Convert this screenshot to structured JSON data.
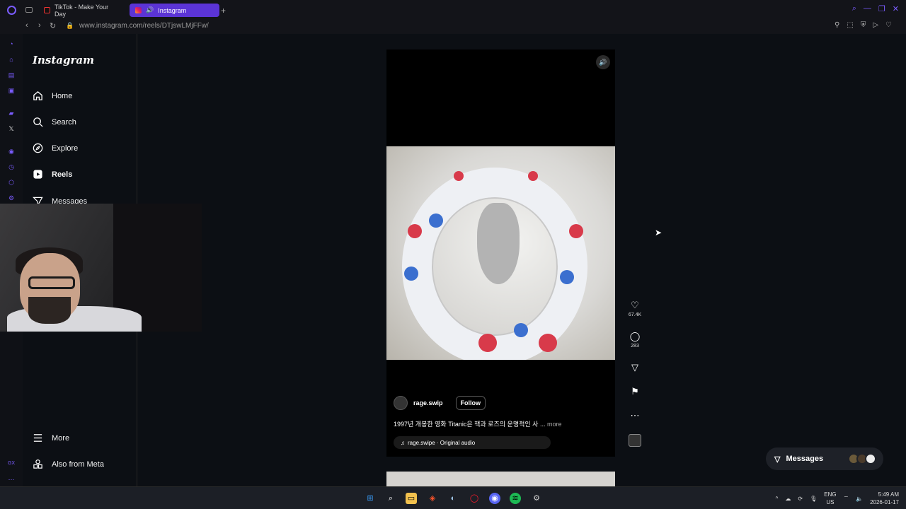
{
  "browser": {
    "tabs": [
      {
        "label": "TikTok - Make Your Day",
        "active": false
      },
      {
        "label": "Instagram",
        "active": true
      }
    ],
    "url": "www.instagram.com/reels/DTjswLMjFFw/",
    "accent_color": "#5b34d6"
  },
  "instagram": {
    "logo": "Instagram",
    "nav": [
      {
        "label": "Home",
        "icon": "home-icon"
      },
      {
        "label": "Search",
        "icon": "search-icon"
      },
      {
        "label": "Explore",
        "icon": "compass-icon"
      },
      {
        "label": "Reels",
        "icon": "reels-icon"
      },
      {
        "label": "Messages",
        "icon": "messages-icon"
      }
    ],
    "bottom_nav": [
      {
        "label": "More",
        "icon": "menu-icon"
      },
      {
        "label": "Also from Meta",
        "icon": "meta-icon"
      }
    ]
  },
  "reel": {
    "username": "rage.swip",
    "follow_label": "Follow",
    "caption": "1997년 개봉한 영화 Titanic은 잭과 로즈의 운명적인 사",
    "caption_ellipsis": "...",
    "more_label": "more",
    "audio": "rage.swipe · Original audio",
    "likes": "67.4K",
    "comments": "283"
  },
  "messages_widget": {
    "label": "Messages"
  },
  "taskbar": {
    "lang_top": "ENG",
    "lang_bottom": "US",
    "time": "5:49 AM",
    "date": "2026-01-17"
  }
}
